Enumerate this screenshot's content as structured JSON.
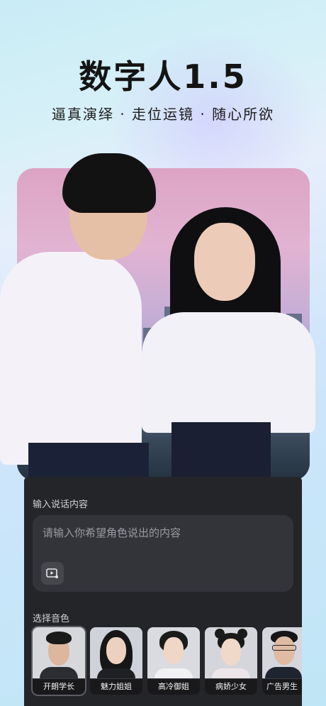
{
  "hero": {
    "title": "数字人1.5",
    "subtitle": "逼真演绎 · 走位运镜 · 随心所欲"
  },
  "input_section": {
    "label": "输入说话内容",
    "placeholder": "请输入你希望角色说出的内容",
    "media_icon": "video-music-icon"
  },
  "voice_section": {
    "label": "选择音色",
    "items": [
      {
        "label": "开朗学长",
        "selected": true
      },
      {
        "label": "魅力姐姐",
        "selected": false
      },
      {
        "label": "高冷御姐",
        "selected": false
      },
      {
        "label": "病娇少女",
        "selected": false
      },
      {
        "label": "广告男生",
        "selected": false
      }
    ]
  },
  "colors": {
    "panel_bg": "#242529",
    "input_bg": "#33343a",
    "label_text": "#cfd0d4",
    "placeholder_text": "#9a9ba1"
  }
}
